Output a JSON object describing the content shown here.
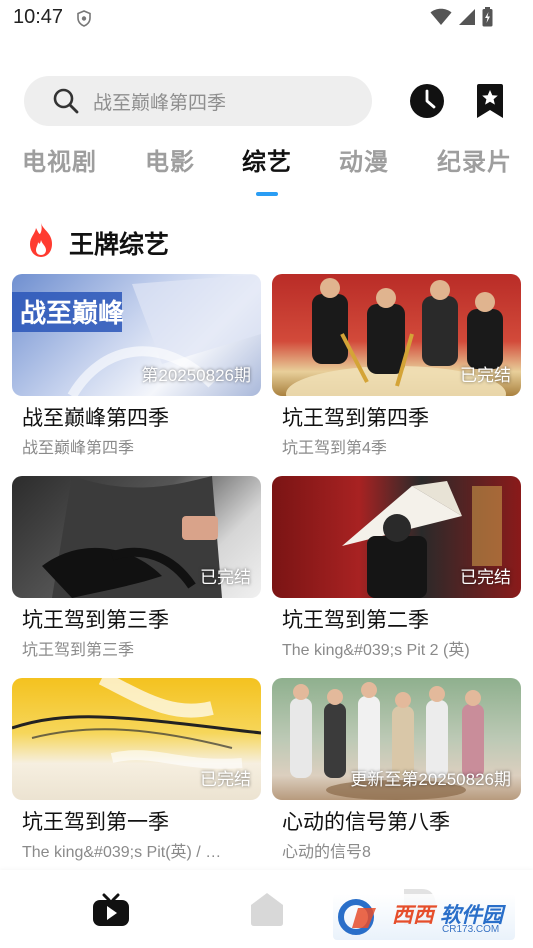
{
  "status_bar": {
    "time": "10:47"
  },
  "search": {
    "placeholder": "战至巅峰第四季"
  },
  "tabs": [
    {
      "label": "电视剧",
      "active": false
    },
    {
      "label": "电影",
      "active": false
    },
    {
      "label": "综艺",
      "active": true
    },
    {
      "label": "动漫",
      "active": false
    },
    {
      "label": "纪录片",
      "active": false
    }
  ],
  "section": {
    "title": "王牌综艺"
  },
  "cards": [
    {
      "title": "战至巅峰第四季",
      "subtitle": "战至巅峰第四季",
      "badge": "第20250826期",
      "thumb_colors": [
        "#8aa3d6",
        "#e9eef7"
      ]
    },
    {
      "title": "坑王驾到第四季",
      "subtitle": "坑王驾到第4季",
      "badge": "已完结",
      "thumb_colors": [
        "#c3312b",
        "#e9c98c"
      ]
    },
    {
      "title": "坑王驾到第三季",
      "subtitle": "坑王驾到第三季",
      "badge": "已完结",
      "thumb_colors": [
        "#3a3a3a",
        "#d9d9d9"
      ]
    },
    {
      "title": "坑王驾到第二季",
      "subtitle": "The king&#039;s Pit 2 (英)",
      "badge": "已完结",
      "thumb_colors": [
        "#7a1414",
        "#2a2a2a"
      ]
    },
    {
      "title": "坑王驾到第一季",
      "subtitle": "The king&#039;s Pit(英) / …",
      "badge": "已完结",
      "thumb_colors": [
        "#f3c22b",
        "#f6efe0"
      ]
    },
    {
      "title": "心动的信号第八季",
      "subtitle": "心动的信号8",
      "badge": "更新至第20250826期",
      "thumb_colors": [
        "#7aa27c",
        "#e6d8c9"
      ]
    }
  ],
  "watermark": {
    "text_a": "西西",
    "text_b": "软件园",
    "url": "CR173.COM"
  },
  "colors": {
    "accent": "#2a9df4",
    "flame": "#ff3b30",
    "tab_inactive": "#9e9e9e"
  }
}
